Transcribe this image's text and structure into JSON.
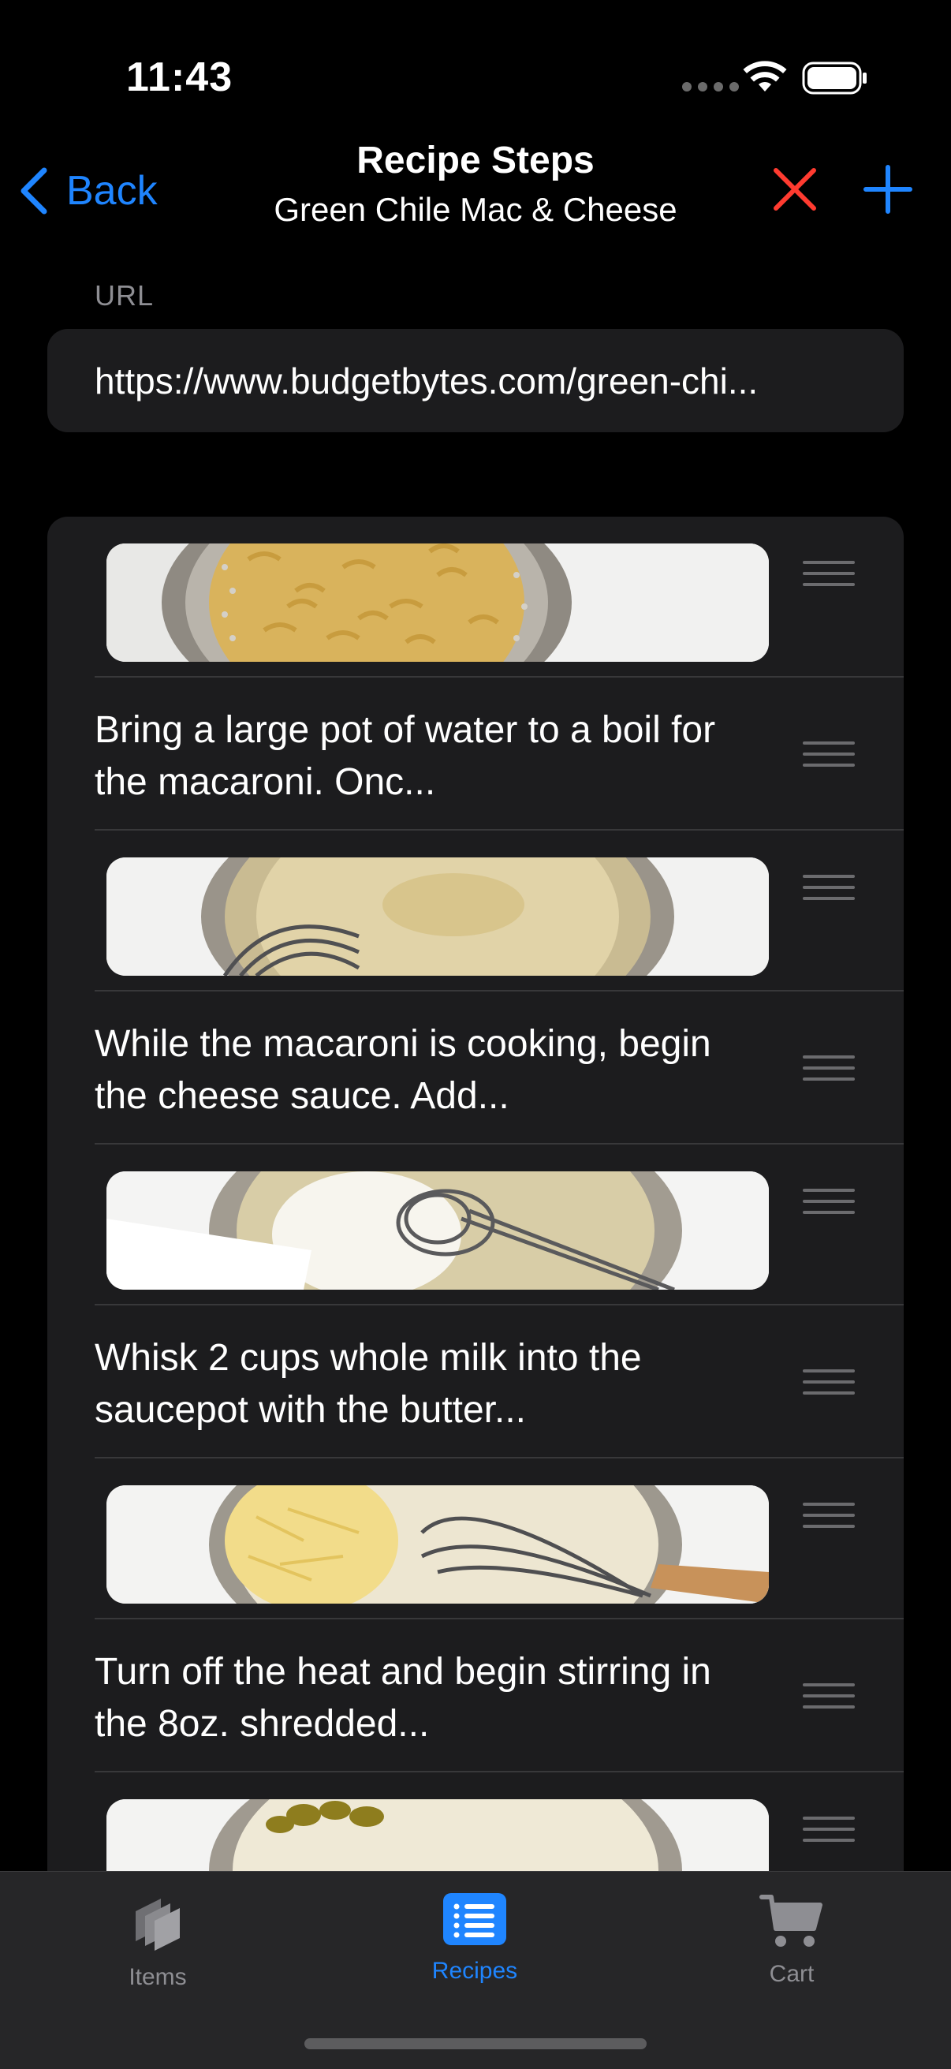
{
  "status": {
    "time": "11:43"
  },
  "nav": {
    "back_label": "Back",
    "title": "Recipe Steps",
    "subtitle": "Green Chile Mac & Cheese",
    "close_icon": "xmark-icon",
    "add_icon": "plus-icon"
  },
  "url": {
    "label": "URL",
    "value": "https://www.budgetbytes.com/green-chi..."
  },
  "steps": [
    {
      "type": "image",
      "description": ""
    },
    {
      "type": "text",
      "line1": "Bring a large pot of water to a boil for",
      "line2": "the macaroni. Onc..."
    },
    {
      "type": "image",
      "description": ""
    },
    {
      "type": "text",
      "line1": "While the macaroni is cooking, begin",
      "line2": "the cheese sauce. Add..."
    },
    {
      "type": "image",
      "description": ""
    },
    {
      "type": "text",
      "line1": "Whisk 2 cups whole milk into the",
      "line2": "saucepot with the butter..."
    },
    {
      "type": "image",
      "description": ""
    },
    {
      "type": "text",
      "line1": "Turn off the heat and begin stirring in",
      "line2": "the 8oz. shredded..."
    },
    {
      "type": "image",
      "description": ""
    }
  ],
  "tabs": [
    {
      "label": "Items",
      "icon": "items-icon",
      "active": false
    },
    {
      "label": "Recipes",
      "icon": "list-icon",
      "active": true
    },
    {
      "label": "Cart",
      "icon": "cart-icon",
      "active": false
    }
  ],
  "colors": {
    "accent": "#1f85ff",
    "destructive": "#ff3b30",
    "card": "#1c1c1e",
    "background": "#000000"
  }
}
